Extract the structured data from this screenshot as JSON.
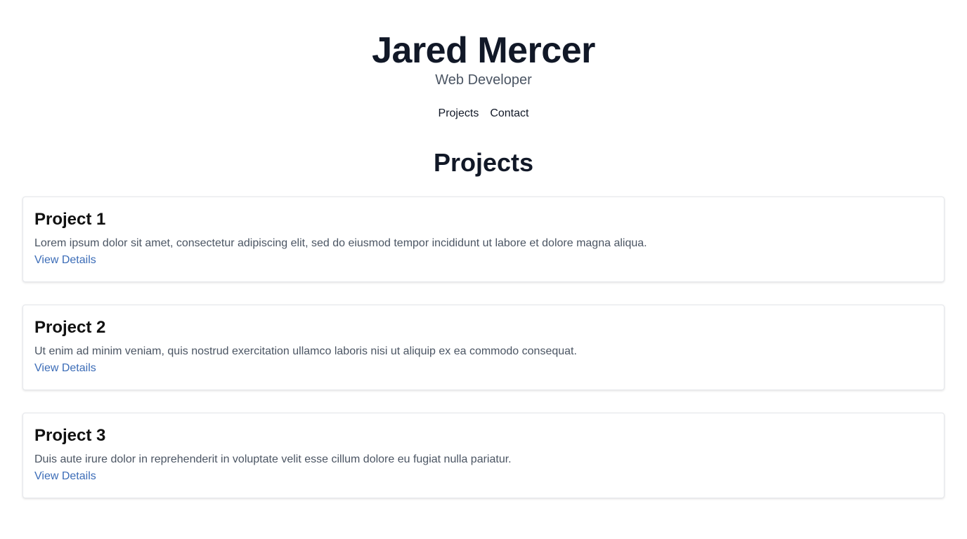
{
  "header": {
    "name": "Jared Mercer",
    "role": "Web Developer"
  },
  "nav": {
    "items": [
      {
        "label": "Projects"
      },
      {
        "label": "Contact"
      }
    ]
  },
  "projects_section": {
    "title": "Projects",
    "items": [
      {
        "title": "Project 1",
        "description": "Lorem ipsum dolor sit amet, consectetur adipiscing elit, sed do eiusmod tempor incididunt ut labore et dolore magna aliqua.",
        "link_label": "View Details"
      },
      {
        "title": "Project 2",
        "description": "Ut enim ad minim veniam, quis nostrud exercitation ullamco laboris nisi ut aliquip ex ea commodo consequat.",
        "link_label": "View Details"
      },
      {
        "title": "Project 3",
        "description": "Duis aute irure dolor in reprehenderit in voluptate velit esse cillum dolore eu fugiat nulla pariatur.",
        "link_label": "View Details"
      }
    ]
  },
  "colors": {
    "heading": "#111827",
    "muted_text": "#4b5563",
    "link": "#3b6cb7",
    "card_border": "#e5e7eb"
  }
}
